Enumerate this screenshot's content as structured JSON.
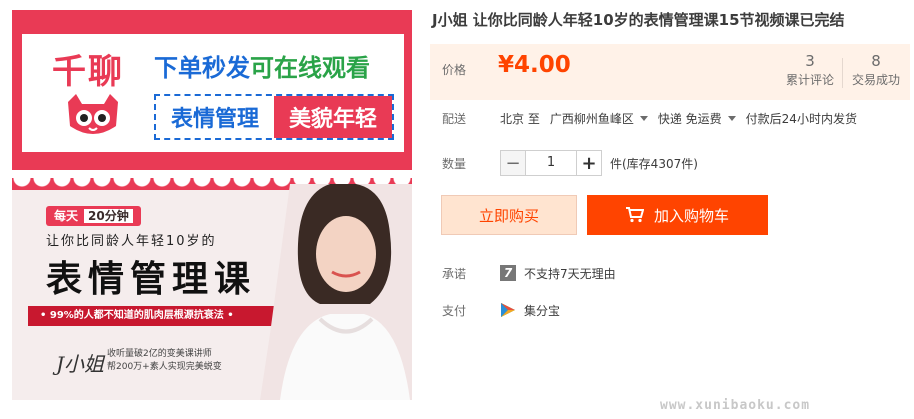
{
  "gallery": {
    "brand_logo": "千聊",
    "promo_line1_a": "下单秒发",
    "promo_line1_b": "可在线观看",
    "promo_box_a": "表情管理",
    "promo_box_b": "美貌年轻",
    "daily_badge": "每天",
    "daily_minutes": "20分钟",
    "subtitle": "让你比同龄人年轻10岁的",
    "course_title": "表情管理课",
    "strip_text": "• 99%的人都不知道的肌肉层根源抗衰法 •",
    "author": "J小姐",
    "author_desc_1": "收听量破2亿的变美课讲师",
    "author_desc_2": "帮200万+素人实现完美蜕变"
  },
  "product": {
    "title": "J小姐 让你比同龄人年轻10岁的表情管理课15节视频课已完结",
    "price_label": "价格",
    "price": "¥4.00",
    "reviews_count": "3",
    "reviews_label": "累计评论",
    "deals_count": "8",
    "deals_label": "交易成功"
  },
  "shipping": {
    "label": "配送",
    "from": "北京 至",
    "to": "广西柳州鱼峰区",
    "method": "快递 免运费",
    "note": "付款后24小时内发货"
  },
  "quantity": {
    "label": "数量",
    "value": "1",
    "minus": "−",
    "plus": "+",
    "stock": "件(库存4307件)"
  },
  "actions": {
    "buy_now": "立即购买",
    "add_to_cart": "加入购物车"
  },
  "promise": {
    "label": "承诺",
    "icon_text": "7",
    "text": "不支持7天无理由"
  },
  "payment": {
    "label": "支付",
    "method": "集分宝"
  },
  "watermark": "www.xunibaoku.com",
  "colors": {
    "accent": "#ff4400",
    "price_bg": "#fff2e8",
    "brand_red": "#e93a55"
  }
}
